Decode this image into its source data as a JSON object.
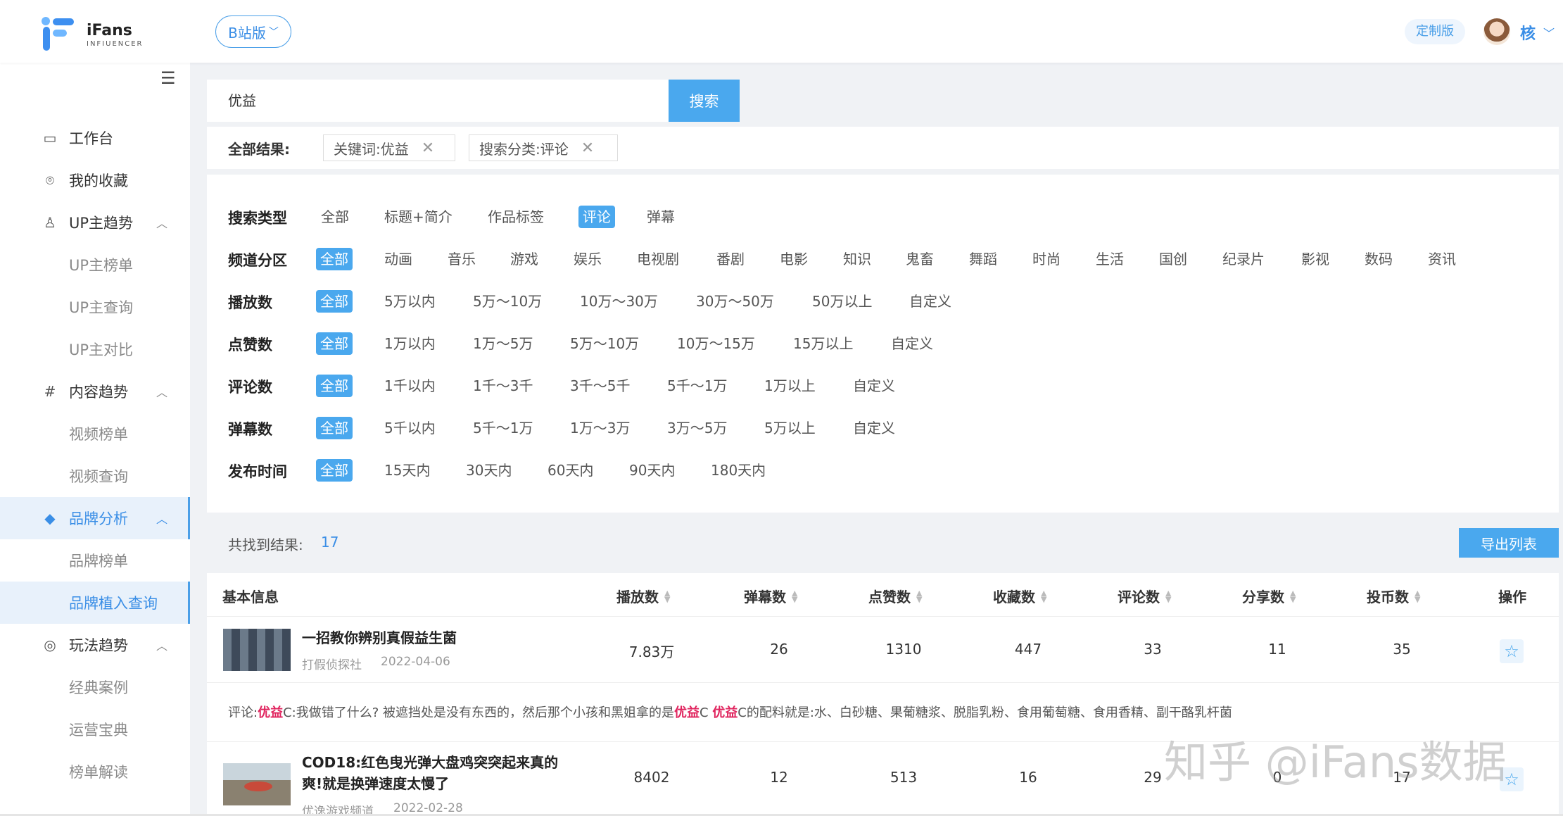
{
  "header": {
    "logo_name": "iFans",
    "logo_sub": "INFIUENCER",
    "version": "B站版",
    "custom_badge": "定制版",
    "user": "核"
  },
  "sidebar": {
    "workbench": "工作台",
    "favorites": "我的收藏",
    "up_trend": "UP主趋势",
    "up_rank": "UP主榜单",
    "up_query": "UP主查询",
    "up_compare": "UP主对比",
    "content_trend": "内容趋势",
    "video_rank": "视频榜单",
    "video_query": "视频查询",
    "brand_analysis": "品牌分析",
    "brand_rank": "品牌榜单",
    "brand_placement": "品牌植入查询",
    "play_trend": "玩法趋势",
    "classic_cases": "经典案例",
    "ops_guide": "运营宝典",
    "rank_explain": "榜单解读"
  },
  "search": {
    "value": "优益",
    "button": "搜索"
  },
  "results": {
    "label": "全部结果:",
    "chip_keyword": "关键词:优益",
    "chip_category": "搜索分类:评论"
  },
  "filters": {
    "search_type": {
      "label": "搜索类型",
      "options": [
        "全部",
        "标题+简介",
        "作品标签",
        "评论",
        "弹幕"
      ]
    },
    "channel": {
      "label": "频道分区",
      "options": [
        "全部",
        "动画",
        "音乐",
        "游戏",
        "娱乐",
        "电视剧",
        "番剧",
        "电影",
        "知识",
        "鬼畜",
        "舞蹈",
        "时尚",
        "生活",
        "国创",
        "纪录片",
        "影视",
        "数码",
        "资讯"
      ]
    },
    "plays": {
      "label": "播放数",
      "options": [
        "全部",
        "5万以内",
        "5万～10万",
        "10万～30万",
        "30万～50万",
        "50万以上",
        "自定义"
      ]
    },
    "likes": {
      "label": "点赞数",
      "options": [
        "全部",
        "1万以内",
        "1万～5万",
        "5万～10万",
        "10万～15万",
        "15万以上",
        "自定义"
      ]
    },
    "comments": {
      "label": "评论数",
      "options": [
        "全部",
        "1千以内",
        "1千～3千",
        "3千～5千",
        "5千～1万",
        "1万以上",
        "自定义"
      ]
    },
    "danmaku": {
      "label": "弹幕数",
      "options": [
        "全部",
        "5千以内",
        "5千～1万",
        "1万～3万",
        "3万～5万",
        "5万以上",
        "自定义"
      ]
    },
    "publish": {
      "label": "发布时间",
      "options": [
        "全部",
        "15天内",
        "30天内",
        "60天内",
        "90天内",
        "180天内"
      ]
    }
  },
  "count": {
    "label": "共找到结果:",
    "value": "17",
    "export": "导出列表"
  },
  "table": {
    "headers": [
      "基本信息",
      "播放数",
      "弹幕数",
      "点赞数",
      "收藏数",
      "评论数",
      "分享数",
      "投币数",
      "操作"
    ],
    "rows": [
      {
        "title": "一招教你辨别真假益生菌",
        "author": "打假侦探社",
        "date": "2022-04-06",
        "plays": "7.83万",
        "danmaku": "26",
        "likes": "1310",
        "favs": "447",
        "comments": "33",
        "shares": "11",
        "coins": "35",
        "comment_prefix": "评论:",
        "comment_parts": [
          "优益",
          "C:我做错了什么?  被遮挡处是没有东西的，然后那个小孩和黑姐拿的是",
          "优益",
          "C  ",
          "优益",
          "C的配料就是:水、白砂糖、果葡糖浆、脱脂乳粉、食用葡萄糖、食用香精、副干酪乳杆菌"
        ]
      },
      {
        "title_line1": "COD18:红色曳光弹大盘鸡突突起来真的",
        "title_line2": "爽!就是换弹速度太慢了",
        "author": "优逸游戏频道",
        "date": "2022-02-28",
        "plays": "8402",
        "danmaku": "12",
        "likes": "513",
        "favs": "16",
        "comments": "29",
        "shares": "0",
        "coins": "17"
      }
    ]
  },
  "watermark": "知乎 @iFans数据"
}
